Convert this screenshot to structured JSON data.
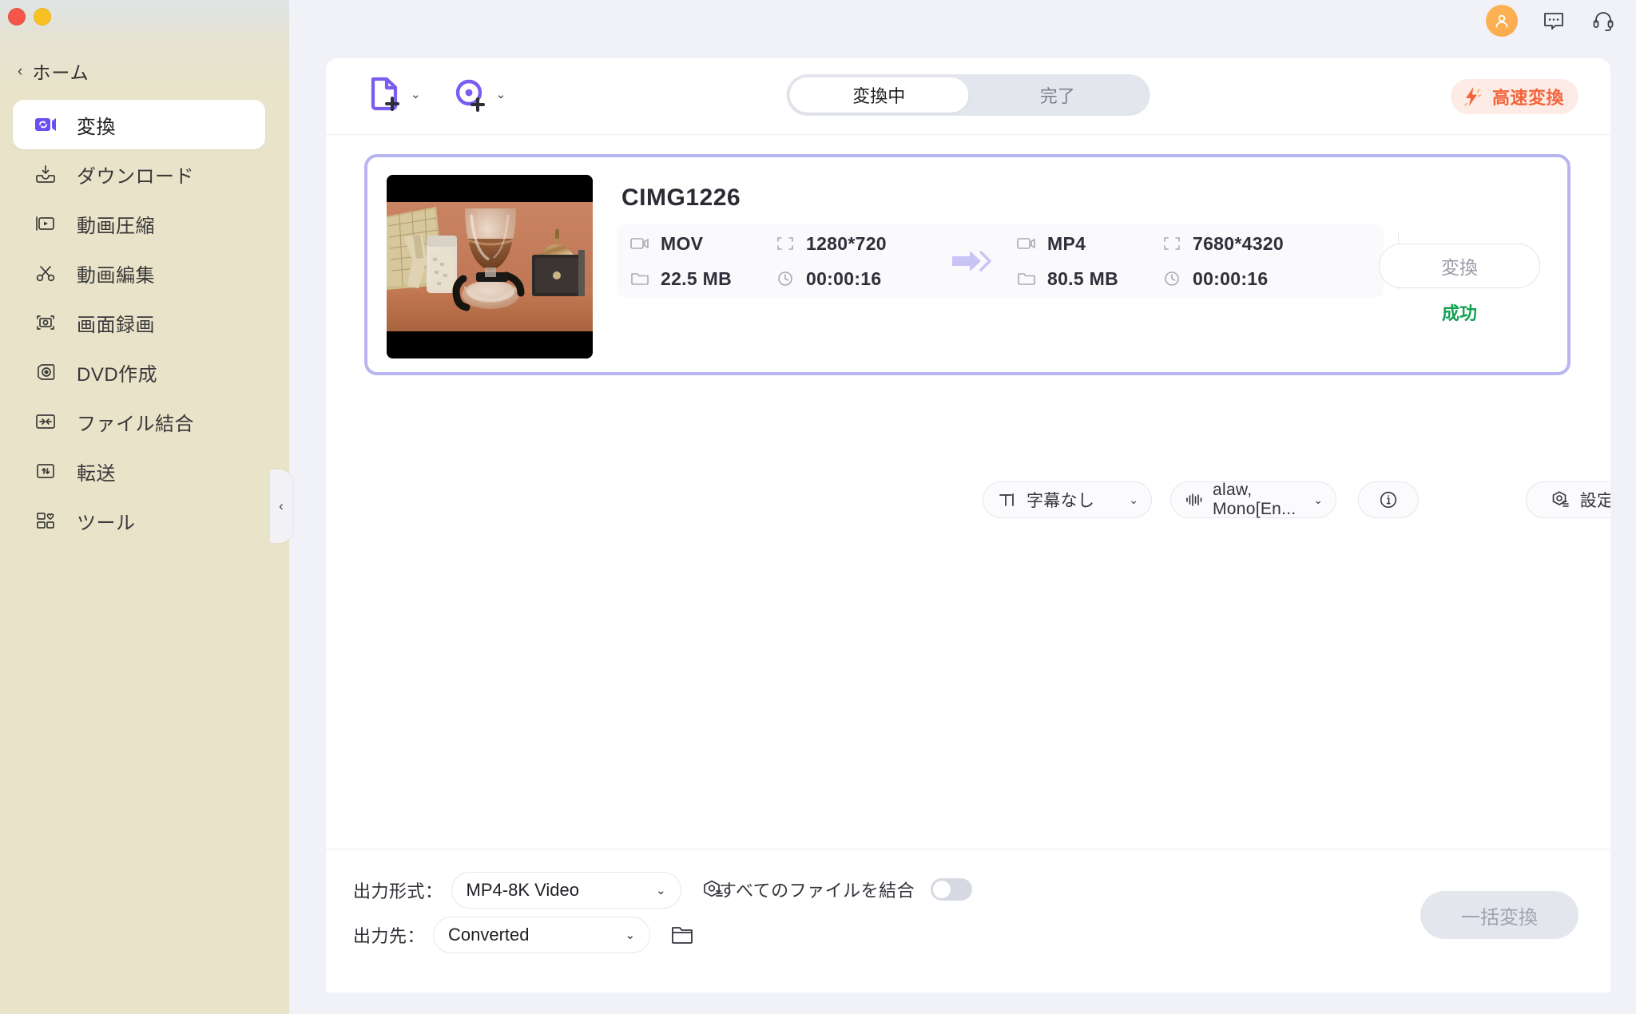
{
  "window": {
    "traffic_lights": [
      "close",
      "minimize"
    ],
    "top_icons": [
      "avatar-icon",
      "feedback-icon",
      "support-icon"
    ]
  },
  "sidebar": {
    "home_label": "ホーム",
    "back_caret": "‹",
    "collapse_caret": "‹",
    "items": [
      {
        "label": "変換",
        "icon": "convert-icon",
        "active": true
      },
      {
        "label": "ダウンロード",
        "icon": "download-icon",
        "active": false
      },
      {
        "label": "動画圧縮",
        "icon": "compress-icon",
        "active": false
      },
      {
        "label": "動画編集",
        "icon": "scissors-icon",
        "active": false
      },
      {
        "label": "画面録画",
        "icon": "screen-record-icon",
        "active": false
      },
      {
        "label": "DVD作成",
        "icon": "dvd-icon",
        "active": false
      },
      {
        "label": "ファイル結合",
        "icon": "merge-icon",
        "active": false
      },
      {
        "label": "転送",
        "icon": "transfer-icon",
        "active": false
      },
      {
        "label": "ツール",
        "icon": "tools-icon",
        "active": false
      }
    ]
  },
  "header": {
    "add_file_label": "add-file",
    "add_disc_label": "add-disc",
    "caret": "⌄",
    "tabs": [
      {
        "label": "変換中",
        "active": true
      },
      {
        "label": "完了",
        "active": false
      }
    ],
    "fast_convert_label": "高速変換",
    "fast_convert_color": "#f4633a"
  },
  "card": {
    "filename": "CIMG1226",
    "selected_border_color": "#b9b5f0",
    "source": {
      "format": "MOV",
      "resolution": "1280*720",
      "filesize": "22.5 MB",
      "duration": "00:00:16"
    },
    "target": {
      "format": "MP4",
      "resolution": "7680*4320",
      "filesize": "80.5 MB",
      "duration": "00:00:16"
    },
    "subtitle_chip": {
      "label": "字幕なし",
      "caret": "⌄"
    },
    "audio_chip": {
      "label": "alaw, Mono[En...",
      "caret": "⌄"
    },
    "info_chip": {
      "label": "i"
    },
    "settings_chip": {
      "label": "設定"
    },
    "convert_button": "変換",
    "status": "成功",
    "status_color": "#13a152"
  },
  "bottom": {
    "format_label": "出力形式：",
    "format_value": "MP4-8K Video",
    "dest_label": "出力先：",
    "dest_value": "Converted",
    "merge_label": "すべてのファイルを結合",
    "merge_on": false,
    "batch_button": "一括変換",
    "caret": "⌄"
  }
}
